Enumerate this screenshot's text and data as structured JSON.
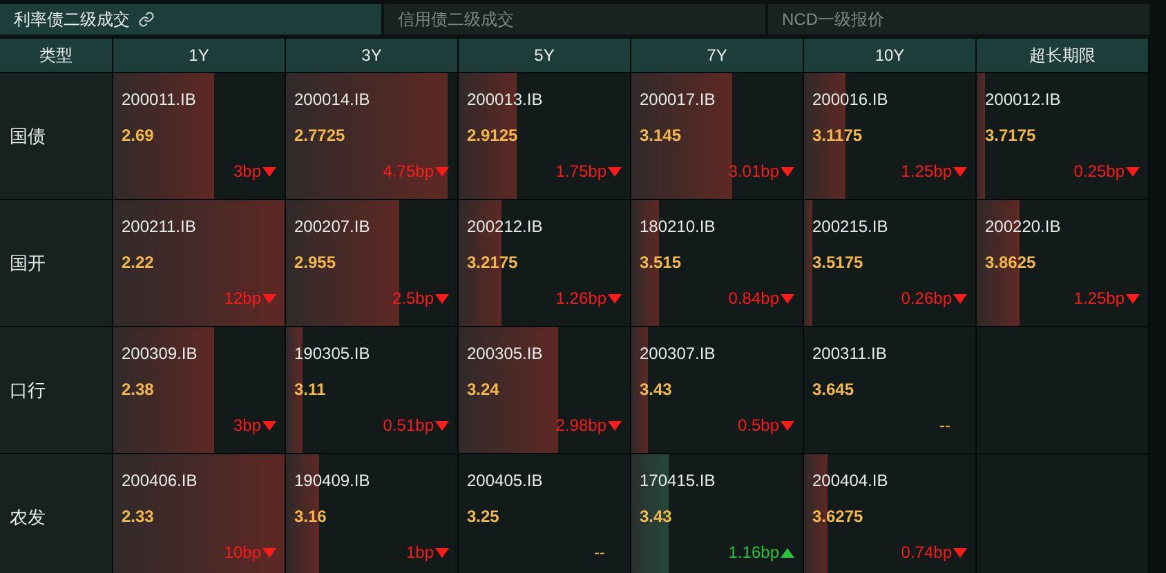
{
  "tabs": [
    {
      "label": "利率债二级成交",
      "selected": true,
      "link": true
    },
    {
      "label": "信用债二级成交",
      "selected": false,
      "link": false
    },
    {
      "label": "NCD一级报价",
      "selected": false,
      "link": false
    }
  ],
  "table": {
    "row_header": "类型",
    "columns": [
      "1Y",
      "3Y",
      "5Y",
      "7Y",
      "10Y",
      "超长期限"
    ],
    "rows": [
      {
        "type": "国债",
        "cells": [
          {
            "kind": "quote",
            "code": "200011.IB",
            "yield": "2.69",
            "change": "3bp",
            "up": false,
            "level": 0.59
          },
          {
            "kind": "quote",
            "code": "200014.IB",
            "yield": "2.7725",
            "change": "4.75bp",
            "up": false,
            "level": 0.94
          },
          {
            "kind": "quote",
            "code": "200013.IB",
            "yield": "2.9125",
            "change": "1.75bp",
            "up": false,
            "level": 0.34
          },
          {
            "kind": "quote",
            "code": "200017.IB",
            "yield": "3.145",
            "change": "3.01bp",
            "up": false,
            "level": 0.59
          },
          {
            "kind": "quote",
            "code": "200016.IB",
            "yield": "3.1175",
            "change": "1.25bp",
            "up": false,
            "level": 0.24
          },
          {
            "kind": "quote",
            "code": "200012.IB",
            "yield": "3.7175",
            "change": "0.25bp",
            "up": false,
            "level": 0.05
          }
        ]
      },
      {
        "type": "国开",
        "cells": [
          {
            "kind": "quote",
            "code": "200211.IB",
            "yield": "2.22",
            "change": "12bp",
            "up": false,
            "level": 1
          },
          {
            "kind": "quote",
            "code": "200207.IB",
            "yield": "2.955",
            "change": "2.5bp",
            "up": false,
            "level": 0.66
          },
          {
            "kind": "quote",
            "code": "200212.IB",
            "yield": "3.2175",
            "change": "1.26bp",
            "up": false,
            "level": 0.25
          },
          {
            "kind": "quote",
            "code": "180210.IB",
            "yield": "3.515",
            "change": "0.84bp",
            "up": false,
            "level": 0.16
          },
          {
            "kind": "quote",
            "code": "200215.IB",
            "yield": "3.5175",
            "change": "0.26bp",
            "up": false,
            "level": 0.05
          },
          {
            "kind": "quote",
            "code": "200220.IB",
            "yield": "3.8625",
            "change": "1.25bp",
            "up": false,
            "level": 0.25
          }
        ]
      },
      {
        "type": "口行",
        "cells": [
          {
            "kind": "quote",
            "code": "200309.IB",
            "yield": "2.38",
            "change": "3bp",
            "up": false,
            "level": 0.59
          },
          {
            "kind": "quote",
            "code": "190305.IB",
            "yield": "3.11",
            "change": "0.51bp",
            "up": false,
            "level": 0.1
          },
          {
            "kind": "quote",
            "code": "200305.IB",
            "yield": "3.24",
            "change": "2.98bp",
            "up": false,
            "level": 0.58
          },
          {
            "kind": "quote",
            "code": "200307.IB",
            "yield": "3.43",
            "change": "0.5bp",
            "up": false,
            "level": 0.1
          },
          {
            "kind": "quote",
            "code": "200311.IB",
            "yield": "3.645",
            "change": "--"
          },
          {
            "kind": "blank"
          }
        ]
      },
      {
        "type": "农发",
        "cells": [
          {
            "kind": "quote",
            "code": "200406.IB",
            "yield": "2.33",
            "change": "10bp",
            "up": false,
            "level": 1
          },
          {
            "kind": "quote",
            "code": "190409.IB",
            "yield": "3.16",
            "change": "1bp",
            "up": false,
            "level": 0.19
          },
          {
            "kind": "quote",
            "code": "200405.IB",
            "yield": "3.25",
            "change": "--"
          },
          {
            "kind": "quote",
            "code": "170415.IB",
            "yield": "3.43",
            "change": "1.16bp",
            "up": true,
            "level": 0.22
          },
          {
            "kind": "quote",
            "code": "200404.IB",
            "yield": "3.6275",
            "change": "0.74bp",
            "up": false,
            "level": 0.14
          },
          {
            "kind": "blank"
          }
        ]
      }
    ]
  }
}
